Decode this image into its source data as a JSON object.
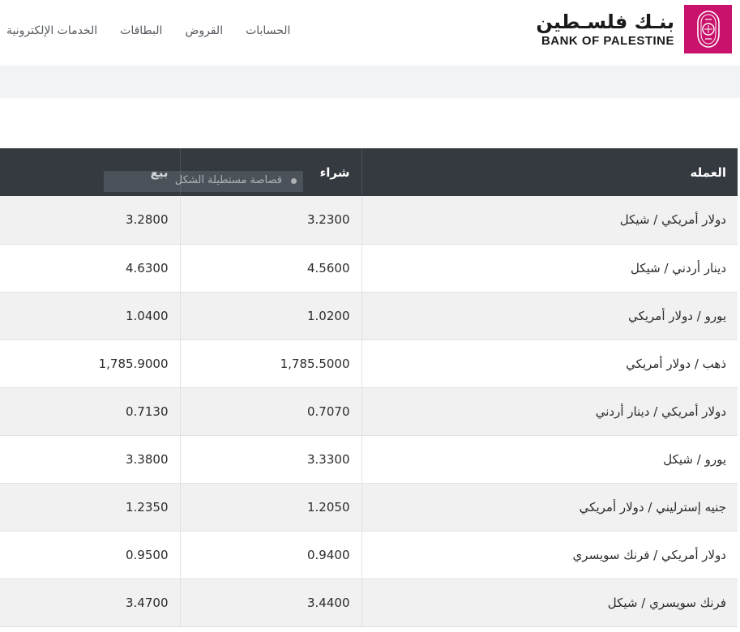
{
  "nav": {
    "items": [
      {
        "label": "الخدمات الإلكترونية"
      },
      {
        "label": "البطاقات"
      },
      {
        "label": "القروض"
      },
      {
        "label": "الحسابات"
      }
    ]
  },
  "logo": {
    "arabic": "بنـك فلسـطين",
    "english": "BANK OF PALESTINE",
    "brand_color": "#c8126b",
    "icon": "bank-emblem-icon"
  },
  "table": {
    "headers": {
      "currency": "العمله",
      "buy": "شراء",
      "sell": "بيع"
    },
    "rows": [
      {
        "currency": "دولار أمريكي / شيكل",
        "buy": "3.2300",
        "sell": "3.2800"
      },
      {
        "currency": "دينار أردني / شيكل",
        "buy": "4.5600",
        "sell": "4.6300"
      },
      {
        "currency": "يورو / دولار أمريكي",
        "buy": "1.0200",
        "sell": "1.0400"
      },
      {
        "currency": "ذهب / دولار أمريكي",
        "buy": "1,785.5000",
        "sell": "1,785.9000"
      },
      {
        "currency": "دولار أمريكي / دينار أردني",
        "buy": "0.7070",
        "sell": "0.7130"
      },
      {
        "currency": "يورو / شيكل",
        "buy": "3.3300",
        "sell": "3.3800"
      },
      {
        "currency": "جنيه إسترليني / دولار أمريكي",
        "buy": "1.2050",
        "sell": "1.2350"
      },
      {
        "currency": "دولار أمريكي / فرنك سويسري",
        "buy": "0.9400",
        "sell": "0.9500"
      },
      {
        "currency": "فرنك سويسري / شيكل",
        "buy": "3.4400",
        "sell": "3.4700"
      }
    ]
  },
  "overlay": {
    "label": "قصاصة مستطيلة الشكل"
  },
  "colors": {
    "header_bg": "#343a40",
    "row_alt": "#f1f1f1",
    "band": "#f2f3f5"
  }
}
